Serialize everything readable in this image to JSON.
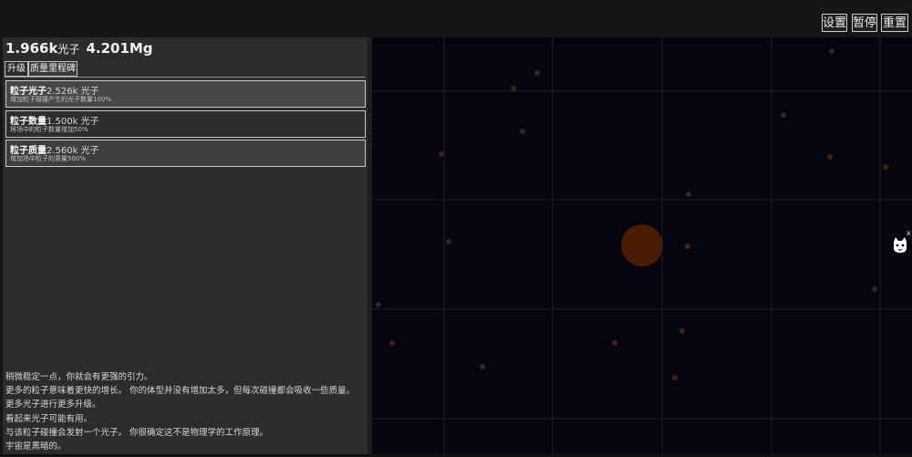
{
  "header": {
    "buttons": {
      "settings": "设置",
      "pause": "暂停",
      "reset": "重置"
    }
  },
  "stats": {
    "photons": "1.966k",
    "photons_unit": "光子",
    "mass": "4.201Mg"
  },
  "tabs": {
    "upgrades": "升级",
    "milestones": "质量里程碑"
  },
  "upgrades": [
    {
      "name": "粒子光子",
      "cost": "2.526k 光子",
      "desc": "增加粒子碰撞产生的光子数量100%"
    },
    {
      "name": "粒子数量",
      "cost": "1.500k 光子",
      "desc": "将场中的粒子数量增加50%"
    },
    {
      "name": "粒子质量",
      "cost": "2.560k 光子",
      "desc": "增加场中粒子的质量500%"
    }
  ],
  "story": [
    "稍微稳定一点，你就会有更强的引力。",
    "更多的粒子意味着更快的增长。 你的体型并没有增加太多，但每次碰撞都会吸收一些质量。",
    "更多光子进行更多升级。",
    "看起来光子可能有用。",
    "与该粒子碰撞会发射一个光子。 你很确定这不是物理学的工作原理。",
    "宇宙是黑暗的。"
  ],
  "game": {
    "colors": {
      "background": "#05050f",
      "grid": "#1b1e36",
      "particle": "#3e2415",
      "player": "#4a1c04"
    },
    "icons": {
      "floating_mascot": "cat-face-icon",
      "close": "close-icon"
    },
    "close_label": "x"
  }
}
